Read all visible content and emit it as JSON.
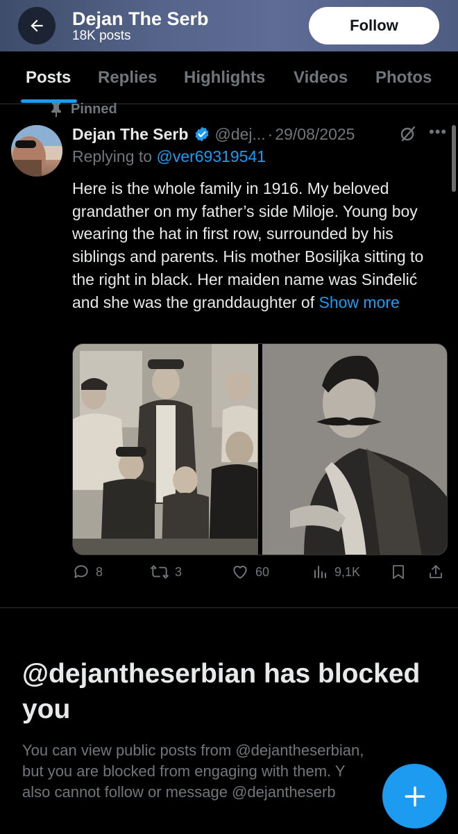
{
  "header": {
    "title": "Dejan The Serb",
    "posts_count": "18K posts",
    "follow_label": "Follow"
  },
  "tabs": [
    {
      "label": "Posts",
      "active": true
    },
    {
      "label": "Replies",
      "active": false
    },
    {
      "label": "Highlights",
      "active": false
    },
    {
      "label": "Videos",
      "active": false
    },
    {
      "label": "Photos",
      "active": false
    }
  ],
  "post": {
    "pinned_label": "Pinned",
    "author_name": "Dejan The Serb",
    "author_handle": "@dej...",
    "date_separator": "·",
    "date": "29/08/2025",
    "replying_to_label": "Replying to",
    "replying_to_handle": "@ver69319541",
    "text": "Here is the whole family in 1916. My beloved grandather on my father’s side Miloje. Young boy wearing the hat in first row, surrounded by his siblings and parents. His mother Bosiljka sitting to the right in black. Her maiden name was Sinđelić and she was the granddaughter of",
    "show_more": "Show more",
    "stats": {
      "replies": "8",
      "reposts": "3",
      "likes": "60",
      "views": "9,1K"
    },
    "icons": [
      "verified-badge-icon",
      "grok-icon",
      "more-icon",
      "reply-icon",
      "repost-icon",
      "like-icon",
      "views-icon",
      "bookmark-icon",
      "share-icon",
      "pin-icon"
    ]
  },
  "blocked": {
    "title": "@dejantheserbian has blocked you",
    "body_lines": [
      "You can view public posts from @dejantheserbian,",
      "but you are blocked from engaging with them. Y",
      "also cannot follow or message @dejantheserb"
    ]
  },
  "colors": {
    "accent": "#1d9bf0",
    "text_primary": "#e7e9ea",
    "text_secondary": "#71767b",
    "background": "#000000",
    "border": "#2f3336"
  }
}
